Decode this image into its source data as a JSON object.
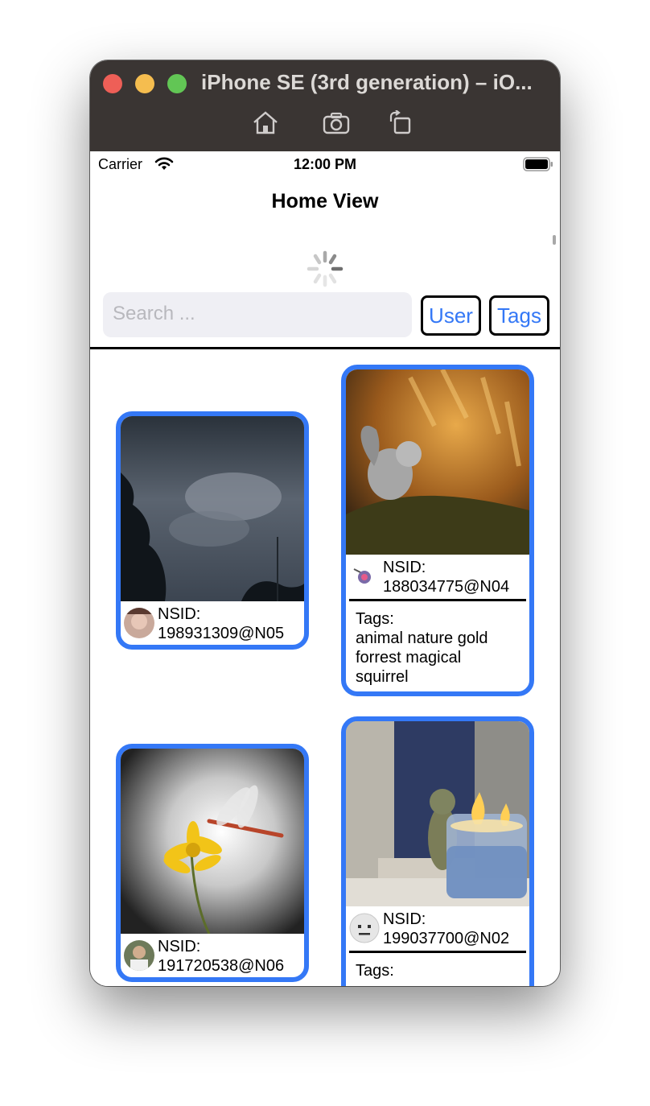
{
  "window": {
    "title": "iPhone SE (3rd generation) – iO..."
  },
  "statusbar": {
    "carrier": "Carrier",
    "time": "12:00 PM"
  },
  "nav": {
    "title": "Home View"
  },
  "search": {
    "placeholder": "Search ..."
  },
  "buttons": {
    "user": "User",
    "tags": "Tags"
  },
  "cards": [
    {
      "nsid_label": "NSID:",
      "nsid": "198931309@N05",
      "photo": "storm-clouds-trees"
    },
    {
      "nsid_label": "NSID:",
      "nsid": "188034775@N04",
      "photo": "squirrel-fern",
      "tags_label": "Tags:",
      "tags": "animal nature gold forrest magical squirrel"
    },
    {
      "nsid_label": "NSID:",
      "nsid": "191720538@N06",
      "photo": "dragonfly-flower"
    },
    {
      "nsid_label": "NSID:",
      "nsid": "199037700@N02",
      "photo": "candle-figurine",
      "tags_label": "Tags:"
    }
  ],
  "colors": {
    "accent": "#3478f6",
    "titlebar": "#3a3533"
  }
}
